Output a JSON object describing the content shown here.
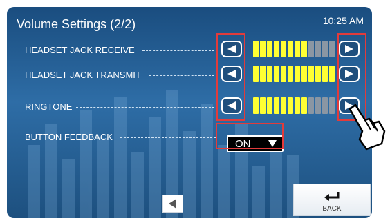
{
  "header": {
    "title": "Volume Settings (2/2)",
    "time": "10:25 AM"
  },
  "rows": [
    {
      "label": "HEADSET JACK RECEIVE",
      "level": 8,
      "max": 12
    },
    {
      "label": "HEADSET JACK TRANSMIT",
      "level": 12,
      "max": 12
    },
    {
      "label": "RINGTONE",
      "level": 8,
      "max": 12
    }
  ],
  "button_feedback": {
    "label": "BUTTON FEEDBACK",
    "value": "ON"
  },
  "footer": {
    "back_label": "BACK"
  },
  "colors": {
    "accent_red": "#e23b3b",
    "bar_on": "#ffff33",
    "bar_off": "#8a96a3"
  }
}
